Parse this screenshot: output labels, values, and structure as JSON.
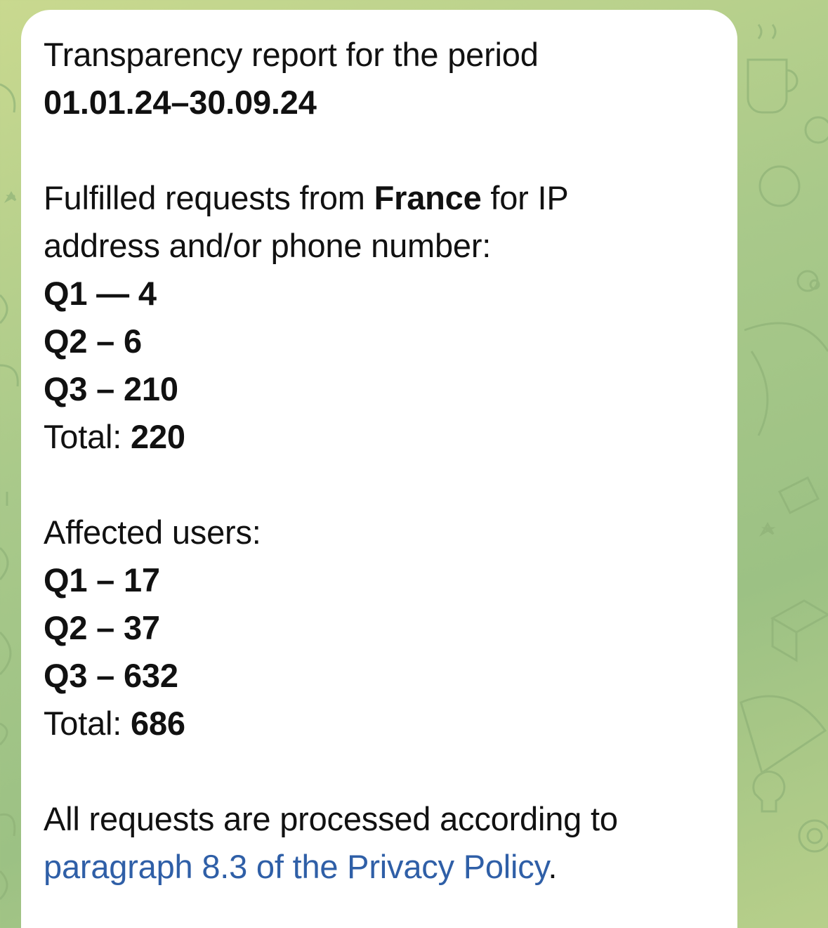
{
  "message": {
    "title_line": "Transparency report for the period",
    "period": "01.01.24–30.09.24",
    "requests": {
      "intro_prefix": "Fulfilled requests from ",
      "country": "France",
      "intro_suffix": " for IP",
      "intro_line2": "address and/or phone number:",
      "quarters": [
        {
          "label": "Q1 — 4"
        },
        {
          "label": "Q2 – 6"
        },
        {
          "label": "Q3 – 210"
        }
      ],
      "total_label": "Total: ",
      "total_value": "220"
    },
    "users": {
      "heading": "Affected users:",
      "quarters": [
        {
          "label": "Q1 – 17"
        },
        {
          "label": "Q2 – 37"
        },
        {
          "label": "Q3 – 632"
        }
      ],
      "total_label": "Total: ",
      "total_value": "686"
    },
    "footer": {
      "line1": "All requests are processed according to",
      "link_text": "paragraph 8.3 of the Privacy Policy",
      "trailing": "."
    }
  },
  "colors": {
    "link": "#2f5fa7",
    "bubble": "#ffffff",
    "wallpaper": "#a9c98a"
  }
}
